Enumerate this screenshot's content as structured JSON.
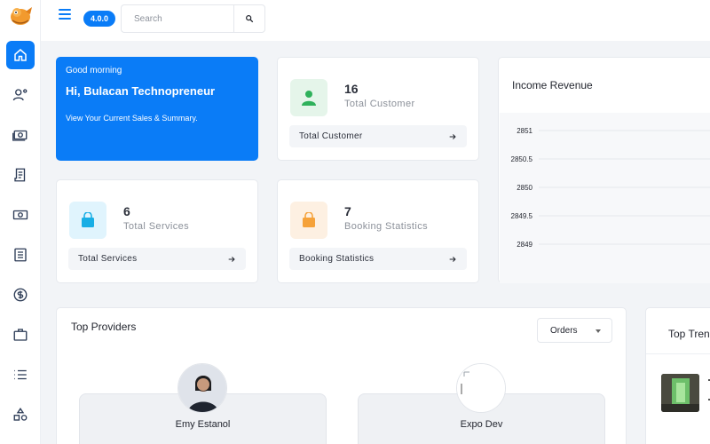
{
  "app": {
    "version": "4.0.0"
  },
  "search": {
    "placeholder": "Search"
  },
  "sidebar": {
    "items": [
      {
        "name": "home",
        "icon": "home-icon",
        "active": true
      },
      {
        "name": "providers",
        "icon": "user-gear-icon"
      },
      {
        "name": "payments",
        "icon": "money-icon"
      },
      {
        "name": "receipts",
        "icon": "receipt-icon"
      },
      {
        "name": "cash",
        "icon": "cash-icon"
      },
      {
        "name": "reports",
        "icon": "list-box-icon"
      },
      {
        "name": "earnings",
        "icon": "dollar-circle-icon"
      },
      {
        "name": "services",
        "icon": "briefcase-icon"
      },
      {
        "name": "lists",
        "icon": "list-icon"
      },
      {
        "name": "categories",
        "icon": "shapes-icon"
      }
    ]
  },
  "welcome": {
    "greeting": "Good morning",
    "title": "Hi, Bulacan Technopreneur",
    "subtitle": "View Your Current Sales & Summary."
  },
  "stats": {
    "customer": {
      "value": "16",
      "label": "Total Customer",
      "button": "Total Customer",
      "color": "#e5f5ea",
      "icon_color": "#2fb15b"
    },
    "services": {
      "value": "6",
      "label": "Total Services",
      "button": "Total Services",
      "color": "#e0f4fd",
      "icon_color": "#18aee5"
    },
    "booking": {
      "value": "7",
      "label": "Booking Statistics",
      "button": "Booking Statistics",
      "color": "#fdf0e2",
      "icon_color": "#f5a23a"
    }
  },
  "income": {
    "title": "Income Revenue",
    "ticks": [
      "2851",
      "2850.5",
      "2850",
      "2849.5",
      "2849"
    ]
  },
  "providers": {
    "title": "Top Providers",
    "filter": "Orders",
    "list": [
      {
        "name": "Emy Estanol"
      },
      {
        "name": "Expo Dev"
      }
    ]
  },
  "trending": {
    "title": "Top Tren"
  },
  "colors": {
    "accent": "#0a7cf7",
    "background": "#f2f4f7"
  }
}
